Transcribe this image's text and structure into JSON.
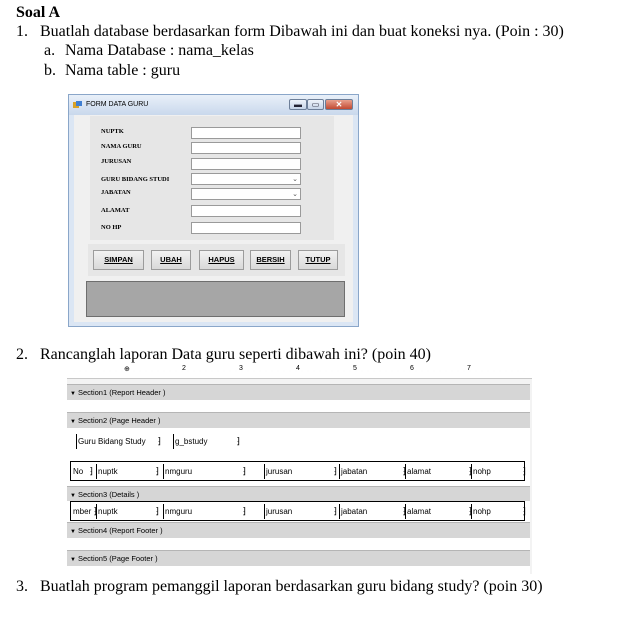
{
  "heading": "Soal A",
  "q1": {
    "number": "1.",
    "text": "Buatlah database berdasarkan form Dibawah ini dan buat koneksi nya. (Poin : 30)",
    "items": [
      {
        "marker": "a.",
        "text": "Nama Database : nama_kelas"
      },
      {
        "marker": "b.",
        "text": "Nama table : guru"
      }
    ]
  },
  "form": {
    "title": "FORM DATA GURU",
    "window_buttons": {
      "minimize": "▬",
      "maximize": "▭",
      "close": "✕"
    },
    "fields": [
      {
        "label": "NUPTK",
        "type": "text"
      },
      {
        "label": "NAMA GURU",
        "type": "text"
      },
      {
        "label": "JURUSAN",
        "type": "text"
      },
      {
        "label": "GURU BIDANG STUDI",
        "type": "combo"
      },
      {
        "label": "JABATAN",
        "type": "combo"
      },
      {
        "label": "ALAMAT",
        "type": "text"
      },
      {
        "label": "NO HP",
        "type": "text"
      }
    ],
    "combo_arrow": "⌄",
    "buttons": [
      "SIMPAN",
      "UBAH",
      "HAPUS",
      "BERSIH",
      "TUTUP"
    ]
  },
  "q2": {
    "number": "2.",
    "text": "Rancanglah laporan Data guru seperti dibawah ini? (poin 40)"
  },
  "report": {
    "ruler_numbers": [
      "1",
      "2",
      "3",
      "4",
      "5",
      "6",
      "7"
    ],
    "sections": [
      "Section1 (Report Header )",
      "Section2 (Page Header )",
      "Section3 (Details )",
      "Section4 (Report Footer )",
      "Section5 (Page Footer )"
    ],
    "page_header": {
      "label": "Guru Bidang Study",
      "field": "g_bstudy"
    },
    "header_row": [
      "No",
      "nuptk",
      "nmguru",
      "jurusan",
      "jabatan",
      "alamat",
      "nohp"
    ],
    "detail_row": [
      "mber",
      "nuptk",
      "nmguru",
      "jurusan",
      "jabatan",
      "alamat",
      "nohp"
    ]
  },
  "q3": {
    "number": "3.",
    "text": "Buatlah program pemanggil laporan berdasarkan guru bidang study? (poin 30)"
  }
}
